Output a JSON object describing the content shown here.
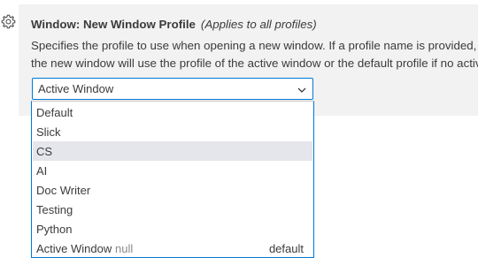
{
  "setting": {
    "category": "Window: ",
    "name": "New Window Profile",
    "scope": "(Applies to all profiles)",
    "description_line1": "Specifies the profile to use when opening a new window. If a profile name is provided,",
    "description_line2": "the new window will use the profile of the active window or the default profile if no active"
  },
  "select": {
    "value": "Active Window",
    "icon": "chevron-down-icon"
  },
  "gear_icon": "gear-icon",
  "options": [
    {
      "label": "Default"
    },
    {
      "label": "Slick"
    },
    {
      "label": "CS",
      "hovered": true
    },
    {
      "label": "AI"
    },
    {
      "label": "Doc Writer"
    },
    {
      "label": "Testing"
    },
    {
      "label": "Python"
    },
    {
      "label": "Active Window",
      "null_text": "null",
      "right_text": "default"
    }
  ],
  "colors": {
    "focus_border": "#0078d4",
    "panel_bg": "#f2f2f2",
    "hover_bg": "#e4e6eb"
  }
}
